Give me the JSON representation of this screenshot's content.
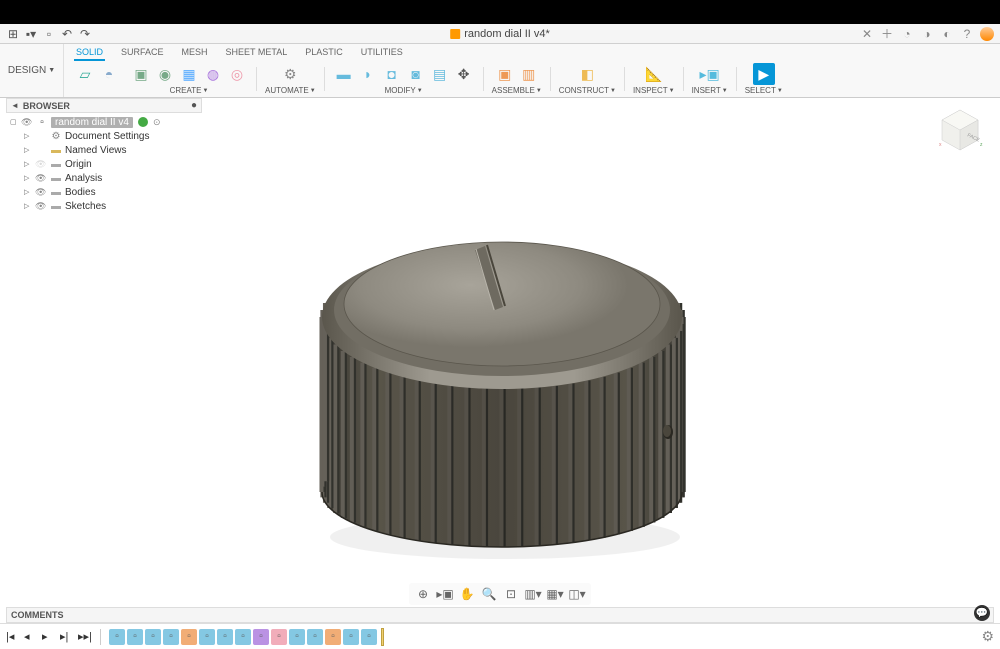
{
  "title": "random dial II v4*",
  "app_menu_icons": [
    "grid-icon",
    "file-icon",
    "dropdown-icon",
    "save-icon",
    "undo-icon",
    "redo-icon"
  ],
  "title_right_icons": [
    "close-icon",
    "new-icon",
    "extensions-icon",
    "notifications-icon",
    "jobs-icon",
    "help-icon"
  ],
  "design_label": "DESIGN",
  "ribbon_tabs": [
    "SOLID",
    "SURFACE",
    "MESH",
    "SHEET METAL",
    "PLASTIC",
    "UTILITIES"
  ],
  "active_tab": 0,
  "ribbon_groups": {
    "sketch": "",
    "create": "CREATE",
    "automate": "AUTOMATE",
    "modify": "MODIFY",
    "assemble": "ASSEMBLE",
    "construct": "CONSTRUCT",
    "inspect": "INSPECT",
    "insert": "INSERT",
    "select": "SELECT"
  },
  "browser": {
    "title": "BROWSER",
    "root": "random dial II v4",
    "items": [
      {
        "label": "Document Settings",
        "icon": "gear"
      },
      {
        "label": "Named Views",
        "icon": "folder"
      },
      {
        "label": "Origin",
        "icon": "folder-hidden"
      },
      {
        "label": "Analysis",
        "icon": "folder"
      },
      {
        "label": "Bodies",
        "icon": "folder"
      },
      {
        "label": "Sketches",
        "icon": "folder"
      }
    ]
  },
  "viewcube_face": "FACE",
  "comments_title": "COMMENTS",
  "viewport_tools": [
    "orbit",
    "look",
    "pan-hand",
    "zoom",
    "fit",
    "display",
    "grid",
    "viewports"
  ],
  "timeline": {
    "playback": [
      "first",
      "prev",
      "play",
      "next",
      "last"
    ],
    "features_count": 15
  }
}
